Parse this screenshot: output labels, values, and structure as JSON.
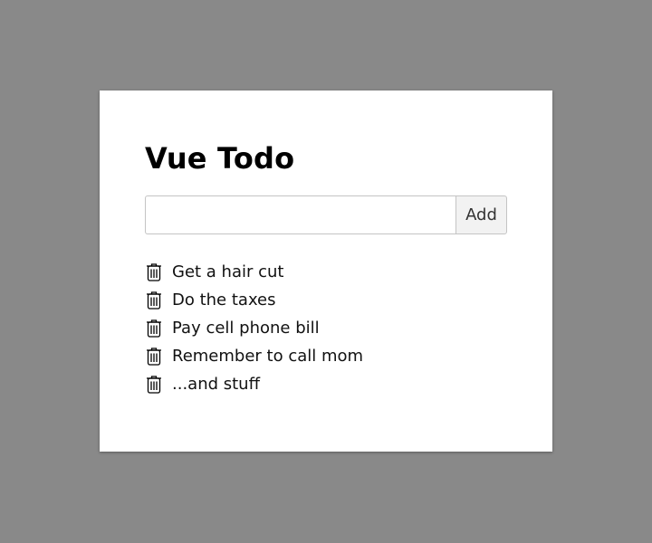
{
  "app": {
    "title": "Vue Todo"
  },
  "form": {
    "input_value": "",
    "input_placeholder": "",
    "add_label": "Add"
  },
  "todos": [
    {
      "text": "Get a hair cut",
      "icon": "trash-icon"
    },
    {
      "text": "Do the taxes",
      "icon": "trash-icon"
    },
    {
      "text": "Pay cell phone bill",
      "icon": "trash-icon"
    },
    {
      "text": "Remember to call mom",
      "icon": "trash-icon"
    },
    {
      "text": "...and stuff",
      "icon": "trash-icon"
    }
  ],
  "colors": {
    "background": "#898989",
    "card": "#ffffff",
    "button_bg": "#f2f2f2",
    "border": "#c4c4c4"
  }
}
